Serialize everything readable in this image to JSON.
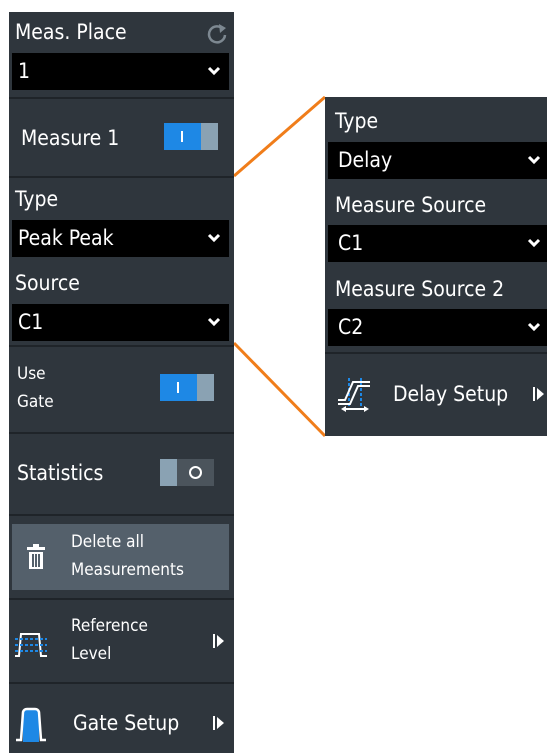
{
  "left_panel": {
    "meas_place": {
      "label": "Meas. Place",
      "value": "1"
    },
    "measure": {
      "label": "Measure 1",
      "state": "on"
    },
    "type": {
      "label": "Type",
      "value": "Peak Peak"
    },
    "source": {
      "label": "Source",
      "value": "C1"
    },
    "use_gate": {
      "label_line1": "Use",
      "label_line2": "Gate",
      "state": "on"
    },
    "statistics": {
      "label": "Statistics",
      "state": "off"
    },
    "delete_all": {
      "label_line1": "Delete all",
      "label_line2": "Measurements"
    },
    "reference_level": {
      "label_line1": "Reference",
      "label_line2": "Level"
    },
    "gate_setup": {
      "label": "Gate Setup"
    }
  },
  "right_panel": {
    "type": {
      "label": "Type",
      "value": "Delay"
    },
    "measure_source": {
      "label": "Measure Source",
      "value": "C1"
    },
    "measure_source_2": {
      "label": "Measure Source 2",
      "value": "C2"
    },
    "delay_setup": {
      "label": "Delay Setup"
    }
  },
  "colors": {
    "panel_bg": "#2f363d",
    "separator": "#1f2429",
    "dropdown_bg": "#000000",
    "toggle_on": "#1e88e5",
    "toggle_knob": "#8aa2b3",
    "delete_button_bg": "#54606b",
    "connector": "#f07d1a"
  },
  "icons": {
    "refresh": "refresh-icon",
    "chevron": "chevron-down-icon",
    "trash": "trash-icon",
    "reference_level": "reference-level-icon",
    "gate": "gate-pulse-icon",
    "delay": "delay-icon",
    "submenu": "submenu-arrow-icon"
  }
}
